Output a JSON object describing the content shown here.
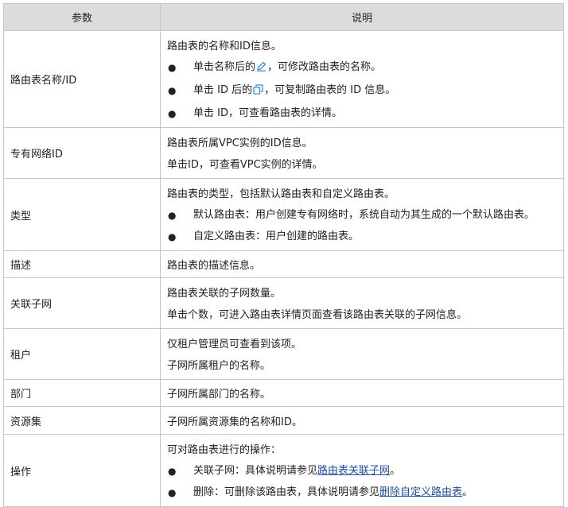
{
  "header": {
    "param": "参数",
    "desc": "说明"
  },
  "rows": {
    "r1": {
      "param": "路由表名称/ID",
      "intro": "路由表的名称和ID信息。",
      "b1_pre": "单击名称后的",
      "b1_post": "，可修改路由表的名称。",
      "b2_pre": "单击 ID 后的",
      "b2_post": "，可复制路由表的 ID 信息。",
      "b3": "单击 ID，可查看路由表的详情。"
    },
    "r2": {
      "param": "专有网络ID",
      "l1": "路由表所属VPC实例的ID信息。",
      "l2": "单击ID，可查看VPC实例的详情。"
    },
    "r3": {
      "param": "类型",
      "intro": "路由表的类型，包括默认路由表和自定义路由表。",
      "b1": "默认路由表：用户创建专有网络时，系统自动为其生成的一个默认路由表。",
      "b2": "自定义路由表：用户创建的路由表。"
    },
    "r4": {
      "param": "描述",
      "l1": "路由表的描述信息。"
    },
    "r5": {
      "param": "关联子网",
      "l1": "路由表关联的子网数量。",
      "l2": "单击个数，可进入路由表详情页面查看该路由表关联的子网信息。"
    },
    "r6": {
      "param": "租户",
      "l1": "仅租户管理员可查看到该项。",
      "l2": "子网所属租户的名称。"
    },
    "r7": {
      "param": "部门",
      "l1": "子网所属部门的名称。"
    },
    "r8": {
      "param": "资源集",
      "l1": "子网所属资源集的名称和ID。"
    },
    "r9": {
      "param": "操作",
      "intro": "可对路由表进行的操作：",
      "b1_pre": "关联子网：具体说明请参见",
      "b1_link": "路由表关联子网",
      "b1_post": "。",
      "b2_pre": "删除：可删除该路由表，具体说明请参见",
      "b2_link": "删除自定义路由表",
      "b2_post": "。"
    }
  },
  "icons": {
    "edit": "pencil-edit-icon",
    "copy": "copy-icon"
  },
  "colors": {
    "header_bg": "#dcdcdc",
    "border": "#c6c6c6",
    "link": "#1f4ea3",
    "icon": "#2e8fd8"
  }
}
